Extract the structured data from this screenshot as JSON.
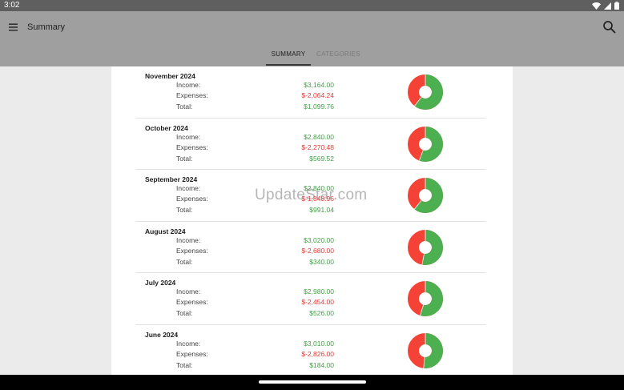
{
  "status_bar": {
    "time": "3:02",
    "icons": [
      "wifi-icon",
      "signal-icon",
      "battery-icon"
    ]
  },
  "app_bar": {
    "title": "Summary",
    "menu_icon": "menu-icon",
    "search_icon": "search-icon"
  },
  "tabs": [
    {
      "label": "SUMMARY",
      "selected": true
    },
    {
      "label": "CATEGORIES",
      "selected": false
    }
  ],
  "labels": {
    "income": "Income:",
    "expenses": "Expenses:",
    "total": "Total:"
  },
  "months": [
    {
      "title": "November 2024",
      "income": "$3,164.00",
      "expenses": "$-2,064.24",
      "total": "$1,099.76",
      "income_share": 0.605
    },
    {
      "title": "October 2024",
      "income": "$2,840.00",
      "expenses": "$-2,270.48",
      "total": "$569.52",
      "income_share": 0.556
    },
    {
      "title": "September 2024",
      "income": "$2,840.00",
      "expenses": "$-1,848.96",
      "total": "$991.04",
      "income_share": 0.606
    },
    {
      "title": "August 2024",
      "income": "$3,020.00",
      "expenses": "$-2,680.00",
      "total": "$340.00",
      "income_share": 0.53
    },
    {
      "title": "July 2024",
      "income": "$2,980.00",
      "expenses": "$-2,454.00",
      "total": "$526.00",
      "income_share": 0.548
    },
    {
      "title": "June 2024",
      "income": "$3,010.00",
      "expenses": "$-2,826.00",
      "total": "$184.00",
      "income_share": 0.516
    }
  ],
  "watermark": "UpdateStar.com",
  "colors": {
    "income": "#43a047",
    "expenses": "#e53935",
    "chart_income": "#4caf50",
    "chart_expenses": "#f44336",
    "app_bar": "#9f9f9f",
    "status_bar": "#5f5f5f"
  }
}
